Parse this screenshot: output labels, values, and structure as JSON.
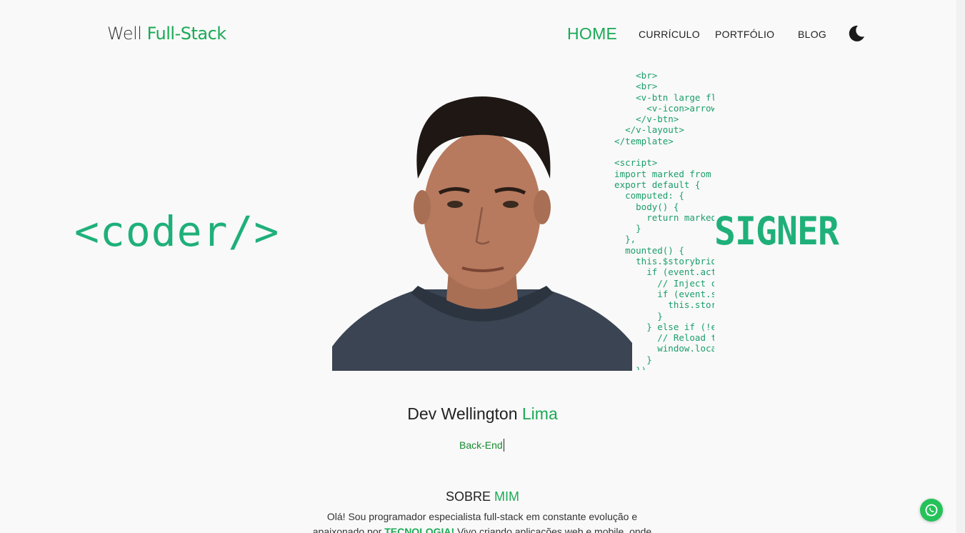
{
  "brand": {
    "light": "Well ",
    "accent": "Full-Stack"
  },
  "nav": {
    "items": [
      {
        "label": "HOME",
        "active": true
      },
      {
        "label": "CURRÍCULO",
        "active": false
      },
      {
        "label": "PORTFÓLIO",
        "active": false
      },
      {
        "label": "BLOG",
        "active": false
      }
    ],
    "theme_toggle_icon": "moon-icon"
  },
  "hero": {
    "left_word": "<coder/>",
    "right_word": "SIGNER",
    "code_lines": [
      "      <br>",
      "      <br>",
      "      <v-btn large fla",
      "        <v-icon>arrow_",
      "      </v-btn>",
      "    </v-layout>",
      "  </template>",
      "",
      "  <script>",
      "  import marked from \"",
      "  export default {",
      "    computed: {",
      "      body() {",
      "        return marked(",
      "      }",
      "    },",
      "    mounted() {",
      "      this.$storybridg",
      "        if (event.acti",
      "          // Inject co",
      "          if (event.st",
      "            this.story",
      "          }",
      "        } else if (!ev",
      "          // Reload th",
      "          window.locat",
      "        }",
      "      })"
    ]
  },
  "profile": {
    "name_prefix": "Dev Wellington ",
    "name_accent": "Lima",
    "role": "Back-End"
  },
  "about": {
    "title_prefix": "SOBRE ",
    "title_accent": "MIM",
    "line1": "Olá! Sou programador especialista full-stack em constante evolução e",
    "line2_start": "apaixonado por ",
    "line2_bold": "TECNOLOGIA!",
    "line2_end": " Vivo criando aplicações web e mobile, onde"
  },
  "floating": {
    "whatsapp_icon": "whatsapp-icon"
  },
  "colors": {
    "accent": "#1aaa55",
    "code": "#1a9e6a",
    "background": "#f9f9f9"
  }
}
